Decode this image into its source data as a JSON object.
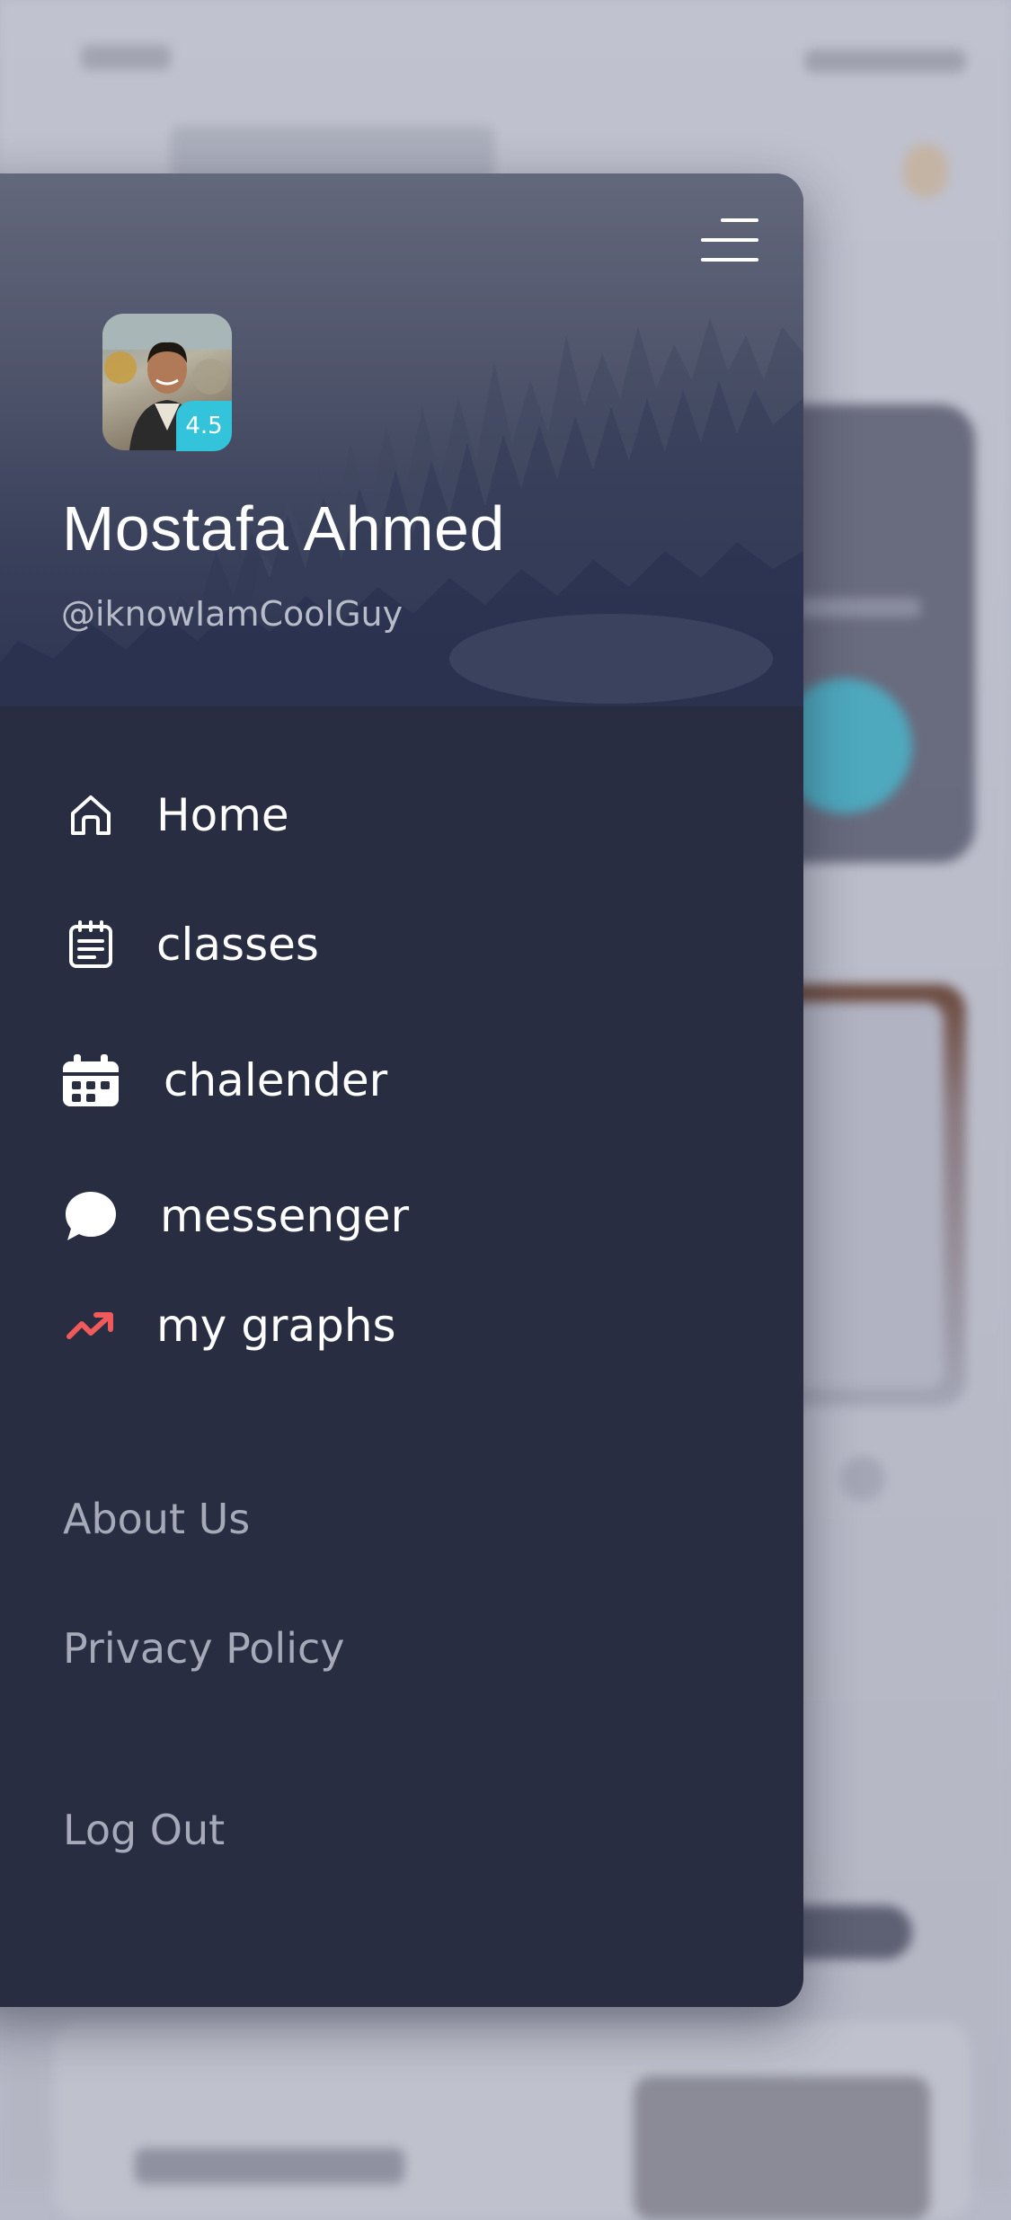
{
  "profile": {
    "name": "Mostafa Ahmed",
    "handle": "@iknowIamCoolGuy",
    "rating": "4.5"
  },
  "menu": [
    {
      "label": "Home",
      "icon": "home-icon"
    },
    {
      "label": "classes",
      "icon": "calendar-list-icon"
    },
    {
      "label": "chalender",
      "icon": "calendar-icon"
    },
    {
      "label": "messenger",
      "icon": "chat-bubble-icon"
    },
    {
      "label": "my graphs",
      "icon": "trending-up-icon"
    }
  ],
  "links": {
    "about": "About Us",
    "privacy": "Privacy Policy",
    "logout": "Log Out"
  },
  "colors": {
    "drawer_bg": "#292d42",
    "badge": "#33c3da",
    "graphs_icon": "#f05a5a",
    "link_text": "#a6a9b8"
  }
}
